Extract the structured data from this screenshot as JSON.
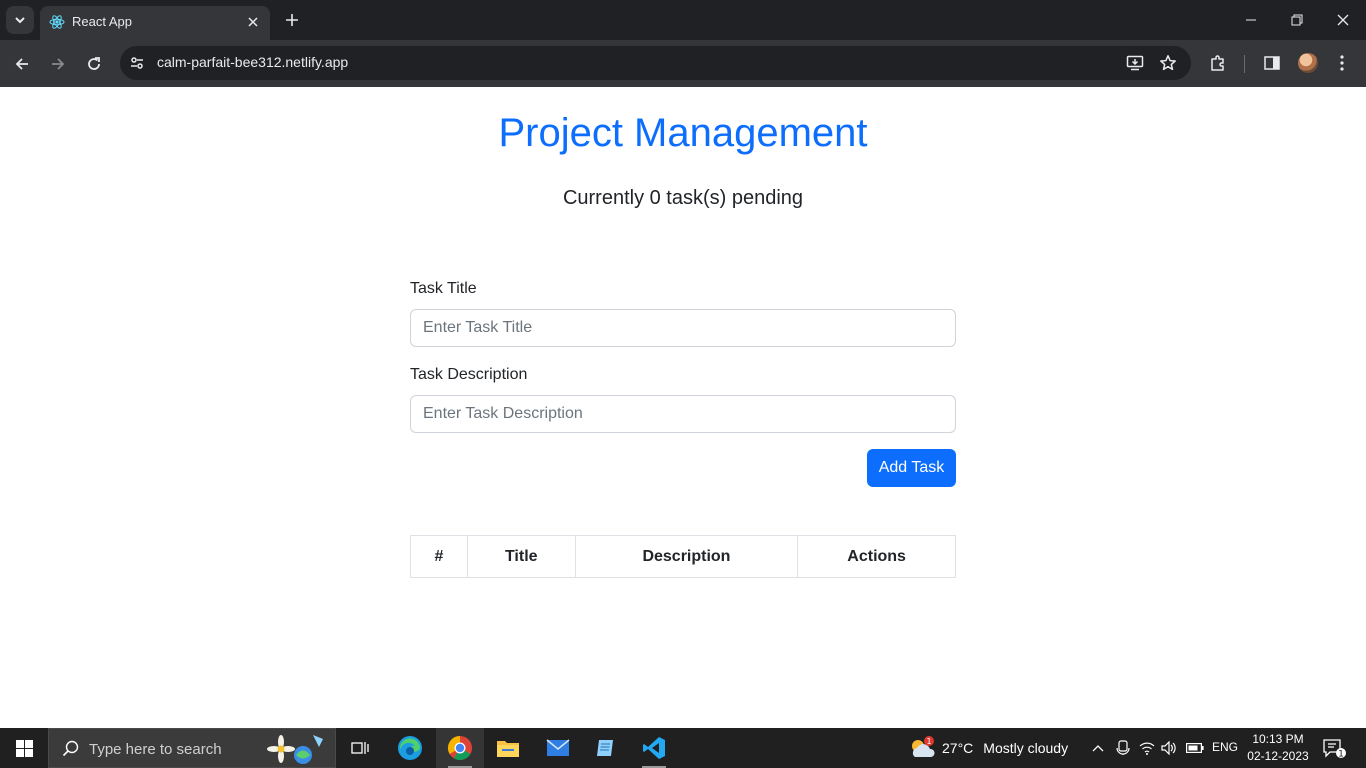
{
  "browser": {
    "tab_title": "React App",
    "url": "calm-parfait-bee312.netlify.app"
  },
  "app": {
    "title": "Project Management",
    "subtitle": "Currently 0 task(s) pending",
    "form": {
      "title_label": "Task Title",
      "title_placeholder": "Enter Task Title",
      "title_value": "",
      "description_label": "Task Description",
      "description_placeholder": "Enter Task Description",
      "description_value": "",
      "submit_label": "Add Task"
    },
    "table": {
      "headers": [
        "#",
        "Title",
        "Description",
        "Actions"
      ],
      "rows": []
    },
    "colors": {
      "primary": "#0d6efd"
    }
  },
  "taskbar": {
    "search_placeholder": "Type here to search",
    "weather": {
      "temperature": "27°C",
      "condition": "Mostly cloudy",
      "badge": "1"
    },
    "language": "ENG",
    "time": "10:13 PM",
    "date": "02-12-2023",
    "notification_count": "1"
  }
}
